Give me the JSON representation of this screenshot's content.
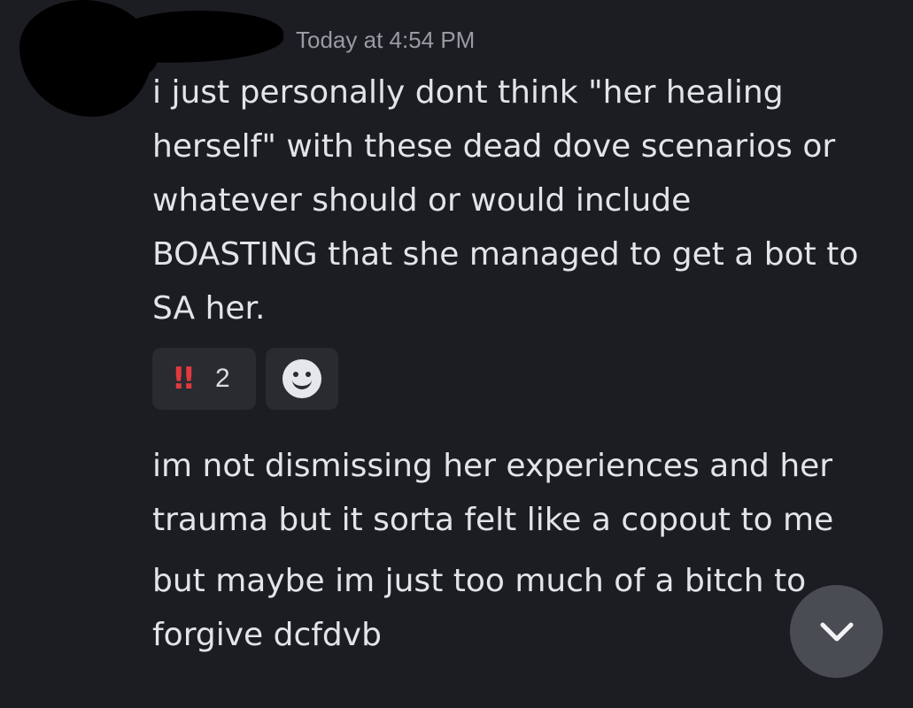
{
  "message_header": {
    "timestamp": "Today at 4:54 PM"
  },
  "messages": [
    {
      "lines": [
        "i just personally dont think \"her healing",
        "herself\" with these dead dove scenarios or",
        "whatever should or would include",
        "BOASTING that she managed to get a bot to",
        "SA her."
      ]
    },
    {
      "lines": [
        "im not dismissing her experiences and her",
        "trauma but it sorta felt like a copout to me"
      ]
    },
    {
      "lines": [
        "but maybe im just too much of a bitch to",
        "forgive dcfdvb"
      ]
    }
  ],
  "reactions": [
    {
      "emoji": "!!",
      "count": "2",
      "emoji_color": "#e23a3f"
    }
  ],
  "icons": {
    "add_reaction": "smile-icon",
    "scroll_down": "chevron-down-icon"
  },
  "colors": {
    "background": "#1c1d22",
    "pill": "#2a2b31",
    "scroll_button": "#4a4c53"
  }
}
